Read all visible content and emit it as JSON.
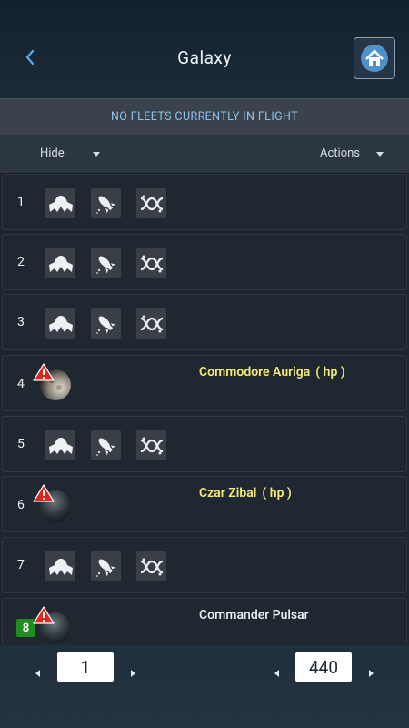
{
  "header": {
    "title": "Galaxy"
  },
  "banner": {
    "text": "NO FLEETS CURRENTLY IN FLIGHT"
  },
  "filters": {
    "hide_label": "Hide",
    "actions_label": "Actions"
  },
  "colors": {
    "player_yellow": "#f5ea78",
    "badge_green": "#1f8d1f",
    "banner_text": "#8fc3ea"
  },
  "rows": [
    {
      "slot": "1",
      "type": "empty",
      "actions": [
        "colonize-icon",
        "espionage-icon",
        "recycle-icon"
      ]
    },
    {
      "slot": "2",
      "type": "empty",
      "actions": [
        "colonize-icon",
        "espionage-icon",
        "recycle-icon"
      ]
    },
    {
      "slot": "3",
      "type": "empty",
      "actions": [
        "colonize-icon",
        "espionage-icon",
        "recycle-icon"
      ]
    },
    {
      "slot": "4",
      "type": "planet",
      "planet_icon": "moon-planet-icon",
      "warning": true,
      "player": "Commodore Auriga",
      "player_status": "( hp )"
    },
    {
      "slot": "5",
      "type": "empty",
      "actions": [
        "colonize-icon",
        "espionage-icon",
        "recycle-icon"
      ]
    },
    {
      "slot": "6",
      "type": "planet",
      "planet_icon": "dark-planet-icon",
      "warning": true,
      "player": "Czar Zibal",
      "player_status": "( hp )"
    },
    {
      "slot": "7",
      "type": "empty",
      "actions": [
        "colonize-icon",
        "espionage-icon",
        "recycle-icon"
      ]
    },
    {
      "slot": "8",
      "type": "planet",
      "planet_icon": "dark-planet-icon",
      "warning": true,
      "player": "Commander Pulsar",
      "player_status": "",
      "own": true
    }
  ],
  "pager": {
    "galaxy": "1",
    "system": "440"
  }
}
